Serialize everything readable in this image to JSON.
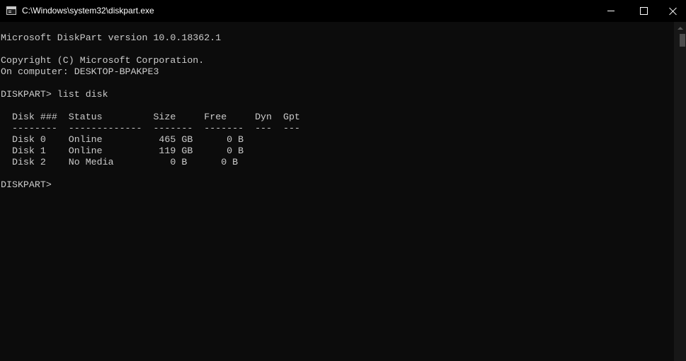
{
  "window": {
    "title": "C:\\Windows\\system32\\diskpart.exe",
    "app_icon": "console-app-icon",
    "controls": {
      "minimize_icon": "minimize-icon",
      "maximize_icon": "maximize-icon",
      "close_icon": "close-icon"
    }
  },
  "console": {
    "background_color": "#0c0c0c",
    "text_color": "#cccccc",
    "lines": [
      "Microsoft DiskPart version 10.0.18362.1",
      "",
      "Copyright (C) Microsoft Corporation.",
      "On computer: DESKTOP-BPAKPE3",
      "",
      "DISKPART> list disk",
      "",
      "  Disk ###  Status         Size     Free     Dyn  Gpt",
      "  --------  -------------  -------  -------  ---  ---",
      "  Disk 0    Online          465 GB      0 B",
      "  Disk 1    Online          119 GB      0 B",
      "  Disk 2    No Media          0 B      0 B",
      "",
      "DISKPART> "
    ]
  }
}
